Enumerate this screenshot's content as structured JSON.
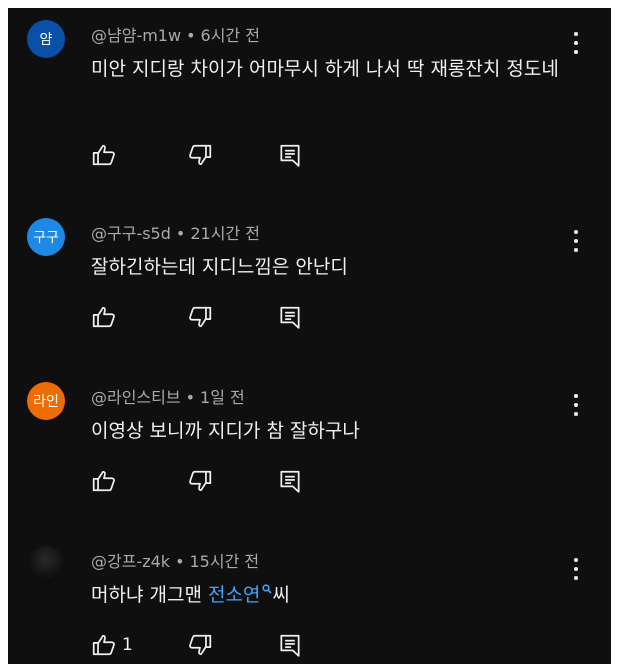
{
  "comments": [
    {
      "avatar_text": "얌",
      "avatar_color": "#0a4fa8",
      "author": "@냠얌-m1w",
      "time": "6시간 전",
      "text": "미안 지디랑 차이가 어마무시 하게 나서 딱 재롱잔치 정도네"
    },
    {
      "avatar_text": "구구",
      "avatar_color": "#1e88e5",
      "author": "@구구-s5d",
      "time": "21시간 전",
      "text": "잘하긴하는데 지디느낌은 안난디"
    },
    {
      "avatar_text": "라인",
      "avatar_color": "#ef6c00",
      "author": "@라인스티브",
      "time": "1일 전",
      "text": "이영상 보니까 지디가 참 잘하구나"
    },
    {
      "avatar_text": "",
      "avatar_color": "#111111",
      "author": "@강프-z4k",
      "time": "15시간 전",
      "text_before": "머하냐 개그맨 ",
      "text_link": "전소연",
      "text_after": "씨",
      "like_count": "1"
    }
  ],
  "separator": "•",
  "icons": {
    "like": "thumbs-up-icon",
    "dislike": "thumbs-down-icon",
    "reply": "reply-icon",
    "menu": "more-vert-icon",
    "search": "search-icon"
  }
}
